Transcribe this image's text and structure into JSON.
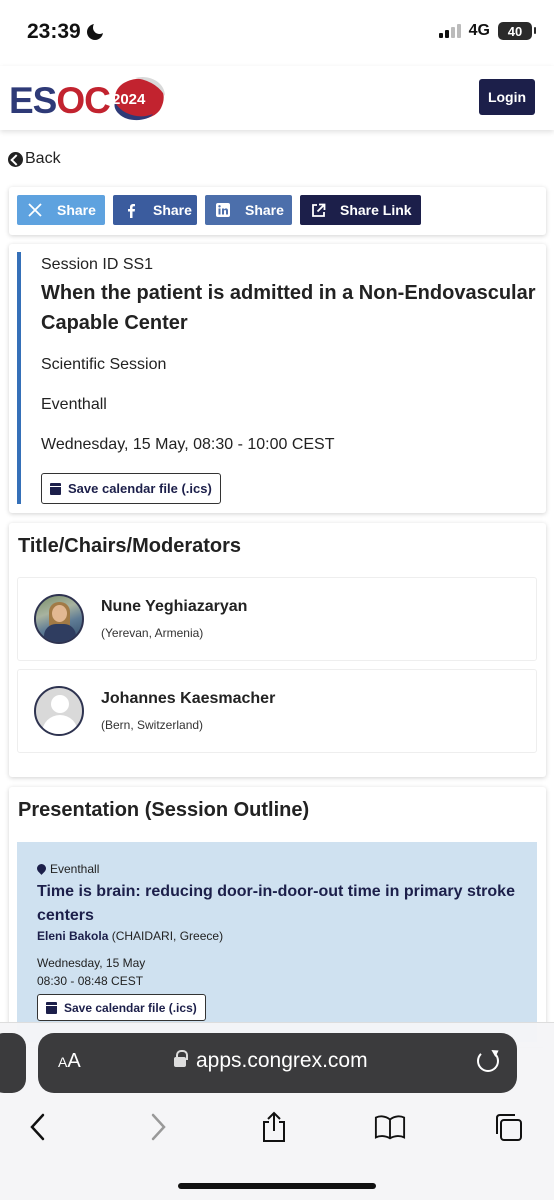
{
  "status_bar": {
    "time": "23:39",
    "network": "4G",
    "battery": "40"
  },
  "header": {
    "logo_text_1": "ES",
    "logo_text_2": "OC",
    "logo_year": "2024",
    "login_label": "Login"
  },
  "back_label": "Back",
  "share": {
    "x_label": "Share",
    "facebook_label": "Share",
    "linkedin_label": "Share",
    "link_label": "Share Link"
  },
  "session": {
    "id_text": "Session ID SS1",
    "title": "When the patient is admitted in a Non-Endovascular Capable Center",
    "type": "Scientific Session",
    "room": "Eventhall",
    "time": "Wednesday, 15 May, 08:30 - 10:00 CEST",
    "calendar_label": "Save calendar file (.ics)"
  },
  "chairs": {
    "heading": "Title/Chairs/Moderators",
    "people": [
      {
        "name": "Nune Yeghiazaryan",
        "location": "(Yerevan, Armenia)"
      },
      {
        "name": "Johannes Kaesmacher",
        "location": "(Bern, Switzerland)"
      }
    ]
  },
  "presentation": {
    "heading": "Presentation (Session Outline)",
    "items": [
      {
        "room": "Eventhall",
        "title": "Time is brain: reducing door-in-door-out time in primary stroke centers",
        "speaker_name": "Eleni Bakola",
        "speaker_location": " (CHAIDARI, Greece)",
        "date": "Wednesday, 15 May",
        "time": "08:30 - 08:48 CEST",
        "calendar_label": "Save calendar file (.ics)"
      }
    ]
  },
  "browser": {
    "text_size_label": "AA",
    "url": "apps.congrex.com"
  },
  "colors": {
    "brand_navy": "#1c1f4a",
    "brand_red": "#c2232f",
    "session_accent": "#3570b8",
    "presentation_bg": "#cfe1f0"
  }
}
